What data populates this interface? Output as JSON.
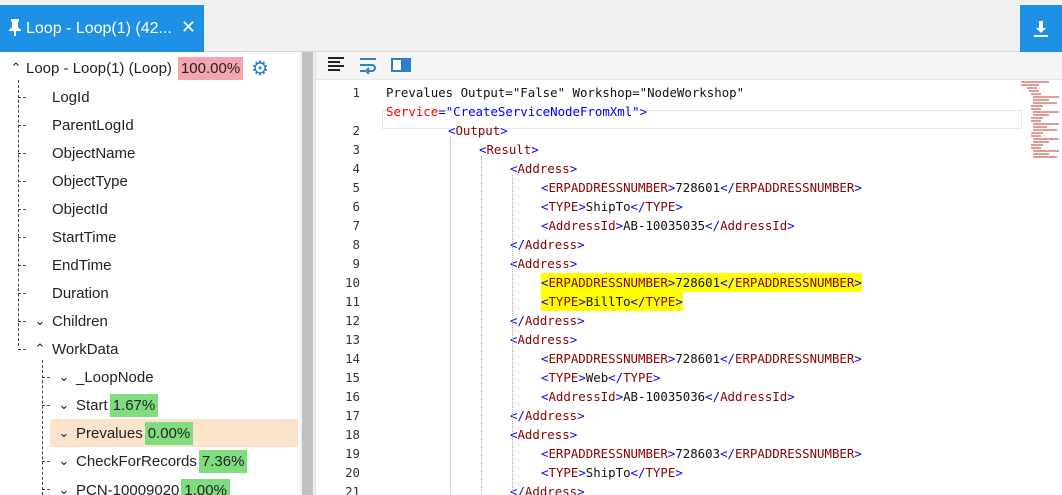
{
  "tab": {
    "title": "Loop - Loop(1) (42...",
    "close": "✕",
    "pin": "📌"
  },
  "colors": {
    "accent": "#1e90e6",
    "highlight": "#ffff00",
    "selected_row": "#fbe3cc"
  },
  "tree": {
    "root": {
      "label": "Loop - Loop(1) (Loop)",
      "percent": "100.00%"
    },
    "fields": [
      "LogId",
      "ParentLogId",
      "ObjectName",
      "ObjectType",
      "ObjectId",
      "StartTime",
      "EndTime",
      "Duration"
    ],
    "children_label": "Children",
    "workdata_label": "WorkData",
    "workdata_items": [
      {
        "label": "_LoopNode",
        "percent": ""
      },
      {
        "label": "Start",
        "percent": "1.67%"
      },
      {
        "label": "Prevalues",
        "percent": "0.00%"
      },
      {
        "label": "CheckForRecords",
        "percent": "7.36%"
      },
      {
        "label": "PCN-10009020",
        "percent": "1.00%"
      }
    ]
  },
  "code": {
    "line_numbers": [
      "1",
      "",
      "2",
      "3",
      "4",
      "5",
      "6",
      "7",
      "8",
      "9",
      "10",
      "11",
      "12",
      "13",
      "14",
      "15",
      "16",
      "17",
      "18",
      "19",
      "20",
      "21"
    ],
    "lines": [
      "<Prevalues Output=\"False\" Workshop=\"NodeWorkshop\"",
      "Service=\"CreateServiceNodeFromXml\">",
      "<Output>",
      "<Result>",
      "<Address>",
      "<ERPADDRESSNUMBER>728601</ERPADDRESSNUMBER>",
      "<TYPE>ShipTo</TYPE>",
      "<AddressId>AB-10035035</AddressId>",
      "</Address>",
      "<Address>",
      "<ERPADDRESSNUMBER>728601</ERPADDRESSNUMBER>",
      "<TYPE>BillTo</TYPE>",
      "</Address>",
      "<Address>",
      "<ERPADDRESSNUMBER>728601</ERPADDRESSNUMBER>",
      "<TYPE>Web</TYPE>",
      "<AddressId>AB-10035036</AddressId>",
      "</Address>",
      "<Address>",
      "<ERPADDRESSNUMBER>728603</ERPADDRESSNUMBER>",
      "<TYPE>ShipTo</TYPE>",
      "</Address>"
    ],
    "highlighted_lines": [
      10,
      11
    ]
  }
}
